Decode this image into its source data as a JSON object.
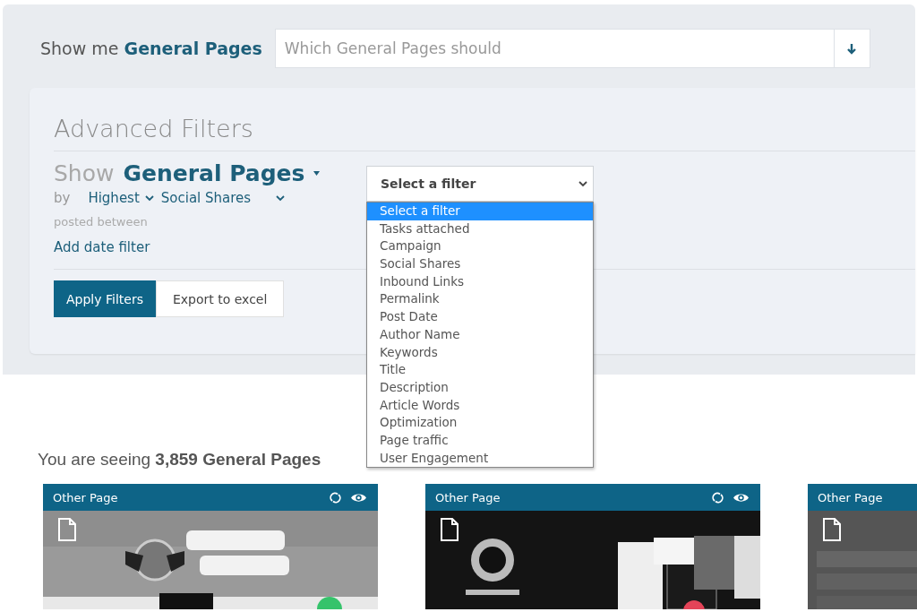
{
  "query": {
    "label": "Show me **General Pages**",
    "placeholder": "Which General Pages should"
  },
  "advanced_filters": {
    "title": "Advanced Filters",
    "show_label": "Show",
    "entity": "General Pages",
    "by_label": "by",
    "order": "Highest",
    "metric": "Social Shares",
    "date_label": "posted between",
    "add_date_link": "Add date filter",
    "buttons": [
      {
        "label": "Apply Filters",
        "kind": "primary"
      },
      {
        "label": "Export to excel",
        "kind": "secondary"
      }
    ]
  },
  "filter_select": {
    "value": "Select a filter",
    "expanded": true,
    "options": [
      {
        "label": "Select a filter",
        "selected": true
      },
      {
        "label": "Tasks attached",
        "selected": false
      },
      {
        "label": "Campaign",
        "selected": false
      },
      {
        "label": "Social Shares",
        "selected": false
      },
      {
        "label": "Inbound Links",
        "selected": false
      },
      {
        "label": "Permalink",
        "selected": false
      },
      {
        "label": "Post Date",
        "selected": false
      },
      {
        "label": "Author Name",
        "selected": false
      },
      {
        "label": "Keywords",
        "selected": false
      },
      {
        "label": "Title",
        "selected": false
      },
      {
        "label": "Description",
        "selected": false
      },
      {
        "label": "Article Words",
        "selected": false
      },
      {
        "label": "Optimization",
        "selected": false
      },
      {
        "label": "Page traffic",
        "selected": false
      },
      {
        "label": "User Engagement",
        "selected": false
      }
    ]
  },
  "results": {
    "summary": "You are seeing **3,859 General Pages**",
    "cards": [
      {
        "type": "Other Page"
      },
      {
        "type": "Other Page"
      },
      {
        "type": "Other Page"
      }
    ]
  }
}
